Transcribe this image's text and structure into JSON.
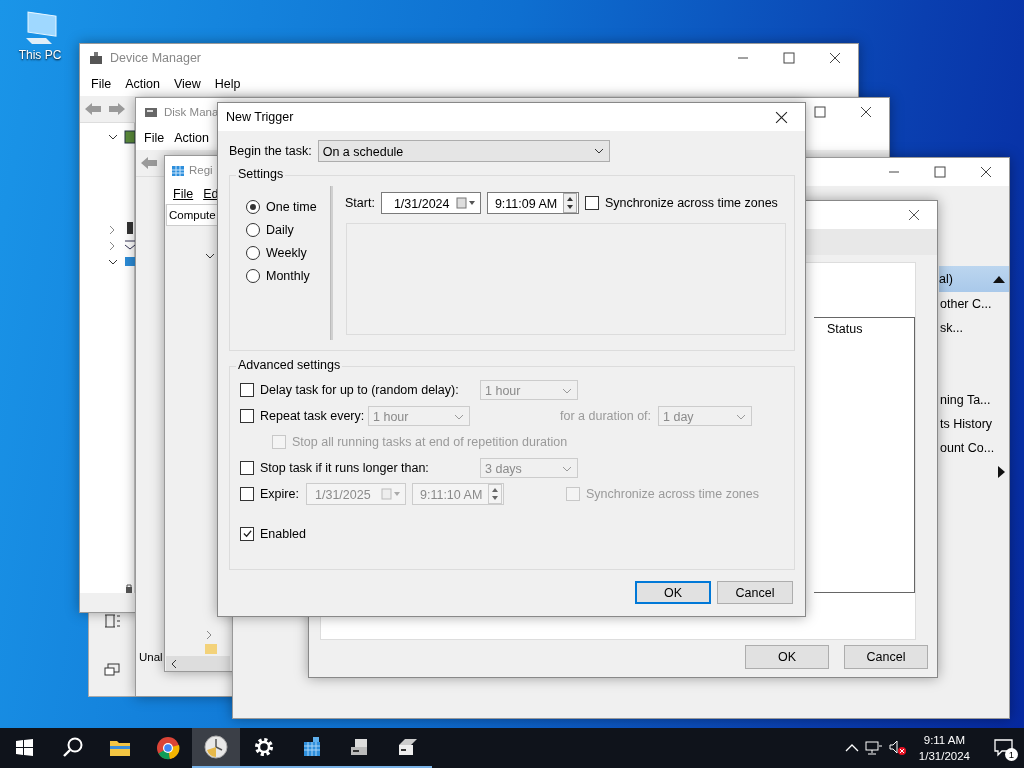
{
  "desktop_icons": [
    {
      "label": "This PC"
    }
  ],
  "device_manager": {
    "title": "Device Manager",
    "menu": [
      "File",
      "Action",
      "View",
      "Help"
    ]
  },
  "disk_management": {
    "title": "Disk Mana",
    "menu": [
      "File",
      "Action"
    ],
    "status_text": "Unal"
  },
  "registry_editor": {
    "title": "Regi",
    "menu": [
      "File",
      "Ed"
    ],
    "address": "Compute"
  },
  "task_scheduler": {
    "actions_header": {
      "label": "al)",
      "selected": true
    },
    "actions_top": [
      "other C...",
      "sk..."
    ],
    "actions_bottom": [
      "ning Ta...",
      "ts History",
      "ount Co..."
    ]
  },
  "create_task": {
    "column": "Status",
    "buttons": [
      "OK",
      "Cancel"
    ]
  },
  "new_trigger": {
    "title": "New Trigger",
    "begin_label": "Begin the task:",
    "begin_value": "On a schedule",
    "settings_label": "Settings",
    "schedule_options": [
      {
        "label": "One time",
        "selected": true
      },
      {
        "label": "Daily",
        "selected": false
      },
      {
        "label": "Weekly",
        "selected": false
      },
      {
        "label": "Monthly",
        "selected": false
      }
    ],
    "start_label": "Start:",
    "start_date": "1/31/2024",
    "start_time": "9:11:09 AM",
    "sync": {
      "label": "Synchronize across time zones",
      "checked": false
    },
    "advanced_label": "Advanced settings",
    "delay": {
      "label": "Delay task for up to (random delay):",
      "checked": false,
      "value": "1 hour"
    },
    "repeat": {
      "label": "Repeat task every:",
      "checked": false,
      "value": "1 hour",
      "duration_label": "for a duration of:",
      "duration_value": "1 day"
    },
    "stop_all": {
      "label": "Stop all running tasks at end of repetition duration",
      "checked": false
    },
    "stop_task": {
      "label": "Stop task if it runs longer than:",
      "checked": false,
      "value": "3 days"
    },
    "expire": {
      "label": "Expire:",
      "checked": false,
      "date": "1/31/2025",
      "time": "9:11:10 AM",
      "sync_label": "Synchronize across time zones",
      "sync_checked": false
    },
    "enabled": {
      "label": "Enabled",
      "checked": true
    },
    "buttons": [
      {
        "label": "OK",
        "default": true
      },
      {
        "label": "Cancel",
        "default": false
      }
    ]
  },
  "taskbar": {
    "apps": [
      {
        "kind": "folder",
        "running": false,
        "active": false
      },
      {
        "kind": "browser",
        "running": false,
        "active": false
      },
      {
        "kind": "clock",
        "running": true,
        "active": true
      },
      {
        "kind": "gear",
        "running": true,
        "active": false
      },
      {
        "kind": "cubes",
        "running": true,
        "active": false
      },
      {
        "kind": "drive",
        "running": true,
        "active": false
      },
      {
        "kind": "drives",
        "running": true,
        "active": false
      }
    ],
    "time": "9:11 AM",
    "date": "1/31/2024",
    "notification_count": "1"
  }
}
